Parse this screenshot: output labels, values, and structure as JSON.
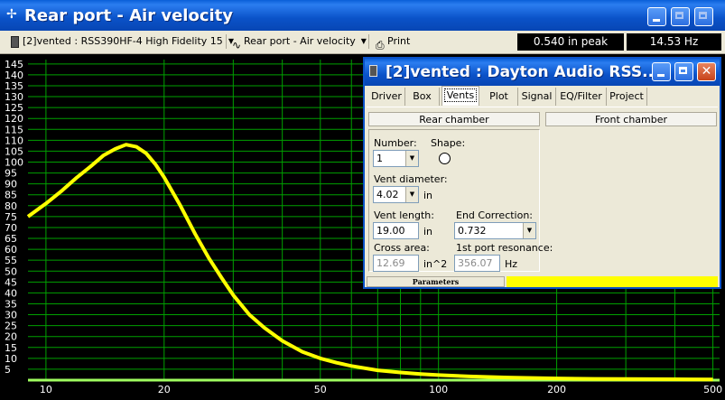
{
  "window": {
    "title": "Rear port - Air velocity",
    "sys_icon": "✢"
  },
  "toolbar": {
    "project_selector": "[2]vented : RSS390HF-4 High Fidelity 15",
    "graph_selector": "Rear port - Air velocity",
    "print_label": "Print",
    "readout_value": "0.540 in peak",
    "readout_freq": "14.53 Hz"
  },
  "dialog": {
    "title": "[2]vented : Dayton Audio RSS...",
    "tabs": [
      {
        "label": "Driver"
      },
      {
        "label": "Box"
      },
      {
        "label": "Vents",
        "active": true
      },
      {
        "label": "Plot"
      },
      {
        "label": "Signal"
      },
      {
        "label": "EQ/Filter"
      },
      {
        "label": "Project"
      }
    ],
    "rear_chamber_label": "Rear chamber",
    "front_chamber_label": "Front chamber",
    "number_label": "Number:",
    "number_value": "1",
    "shape_label": "Shape:",
    "shape_icon": "circle-icon",
    "vent_diameter_label": "Vent diameter:",
    "vent_diameter_value": "4.02",
    "vent_diameter_unit": "in",
    "vent_length_label": "Vent length:",
    "vent_length_value": "19.00",
    "vent_length_unit": "in",
    "end_correction_label": "End Correction:",
    "end_correction_value": "0.732",
    "cross_area_label": "Cross area:",
    "cross_area_value": "12.69",
    "cross_area_unit": "in^2",
    "port_resonance_label": "1st port resonance:",
    "port_resonance_value": "356.07",
    "port_resonance_unit": "Hz",
    "status_label": "Parameters",
    "status_color": "#ffff00"
  },
  "chart_data": {
    "type": "line",
    "background": "#000000",
    "grid_color": "#00a000",
    "curve_color": "#ffff00",
    "x_scale": "log",
    "xlim": [
      9,
      520
    ],
    "ylim": [
      0,
      147
    ],
    "y_ticks": [
      5,
      10,
      15,
      20,
      25,
      30,
      35,
      40,
      45,
      50,
      55,
      60,
      65,
      70,
      75,
      80,
      85,
      90,
      95,
      100,
      105,
      110,
      115,
      120,
      125,
      130,
      135,
      140,
      145
    ],
    "x_tick_labels": [
      {
        "value": 10,
        "label": "10"
      },
      {
        "value": 20,
        "label": "20"
      },
      {
        "value": 50,
        "label": "50"
      },
      {
        "value": 100,
        "label": "100"
      },
      {
        "value": 200,
        "label": "200"
      },
      {
        "value": 500,
        "label": "500"
      }
    ],
    "series": [
      {
        "x": [
          9,
          10,
          11,
          12,
          13,
          14,
          15,
          16,
          17,
          18,
          19,
          20,
          22,
          24,
          26,
          28,
          30,
          33,
          36,
          40,
          45,
          50,
          55,
          60,
          70,
          80,
          90,
          100,
          120,
          150,
          200,
          250,
          300,
          400,
          500
        ],
        "y": [
          75,
          81,
          87,
          93,
          98,
          103,
          106,
          108,
          107,
          104,
          99,
          93,
          80,
          67,
          56,
          47,
          39,
          30,
          24,
          18,
          13,
          10,
          8,
          6.5,
          4.5,
          3.5,
          2.8,
          2.3,
          1.7,
          1.2,
          0.8,
          0.6,
          0.5,
          0.4,
          0.3
        ]
      }
    ]
  }
}
